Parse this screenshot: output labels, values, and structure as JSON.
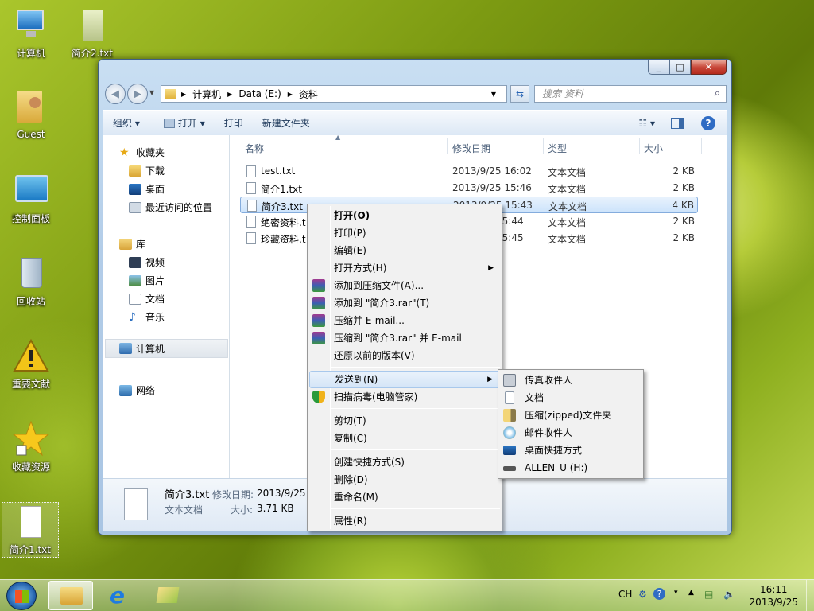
{
  "desktop": {
    "icons": [
      {
        "label": "计算机",
        "icon": "computer-icon"
      },
      {
        "label": "简介2.txt",
        "icon": "text-file-icon"
      },
      {
        "label": "Guest",
        "icon": "user-folder-icon"
      },
      {
        "label": "控制面板",
        "icon": "control-panel-icon"
      },
      {
        "label": "回收站",
        "icon": "recycle-bin-icon"
      },
      {
        "label": "重要文献",
        "icon": "warning-icon"
      },
      {
        "label": "收藏资源",
        "icon": "star-shortcut-icon"
      },
      {
        "label": "简介1.txt",
        "icon": "text-file-icon"
      }
    ]
  },
  "window": {
    "address": {
      "computer": "计算机",
      "drive": "Data (E:)",
      "folder": "资料"
    },
    "search_placeholder": "搜索 资料",
    "toolbar": {
      "organize": "组织",
      "open": "打开",
      "print": "打印",
      "new_folder": "新建文件夹"
    },
    "nav": {
      "favorites": "收藏夹",
      "downloads": "下载",
      "desktop": "桌面",
      "recent": "最近访问的位置",
      "libraries": "库",
      "videos": "视频",
      "pictures": "图片",
      "documents": "文档",
      "music": "音乐",
      "computer": "计算机",
      "network": "网络"
    },
    "columns": {
      "name": "名称",
      "modified": "修改日期",
      "type": "类型",
      "size": "大小"
    },
    "files": [
      {
        "name": "test.txt",
        "modified": "2013/9/25 16:02",
        "type": "文本文档",
        "size": "2 KB"
      },
      {
        "name": "简介1.txt",
        "modified": "2013/9/25 15:46",
        "type": "文本文档",
        "size": "2 KB"
      },
      {
        "name": "简介3.txt",
        "modified": "2013/9/25 15:43",
        "type": "文本文档",
        "size": "4 KB"
      },
      {
        "name": "绝密资料.t",
        "modified": "15:44",
        "type": "文本文档",
        "size": "2 KB"
      },
      {
        "name": "珍藏资料.t",
        "modified": "15:45",
        "type": "文本文档",
        "size": "2 KB"
      }
    ],
    "details": {
      "name": "简介3.txt",
      "modified_label": "修改日期:",
      "modified": "2013/9/25",
      "type": "文本文档",
      "size_label": "大小:",
      "size": "3.71 KB"
    }
  },
  "context_menu": {
    "items": [
      "打开(O)",
      "打印(P)",
      "编辑(E)",
      "打开方式(H)",
      "添加到压缩文件(A)...",
      "添加到 \"简介3.rar\"(T)",
      "压缩并 E-mail...",
      "压缩到 \"简介3.rar\" 并 E-mail",
      "还原以前的版本(V)",
      "发送到(N)",
      "扫描病毒(电脑管家)",
      "剪切(T)",
      "复制(C)",
      "创建快捷方式(S)",
      "删除(D)",
      "重命名(M)",
      "属性(R)"
    ]
  },
  "send_to_menu": {
    "items": [
      "传真收件人",
      "文档",
      "压缩(zipped)文件夹",
      "邮件收件人",
      "桌面快捷方式",
      "ALLEN_U (H:)"
    ]
  },
  "taskbar": {
    "lang": "CH",
    "time": "16:11",
    "date": "2013/9/25"
  }
}
